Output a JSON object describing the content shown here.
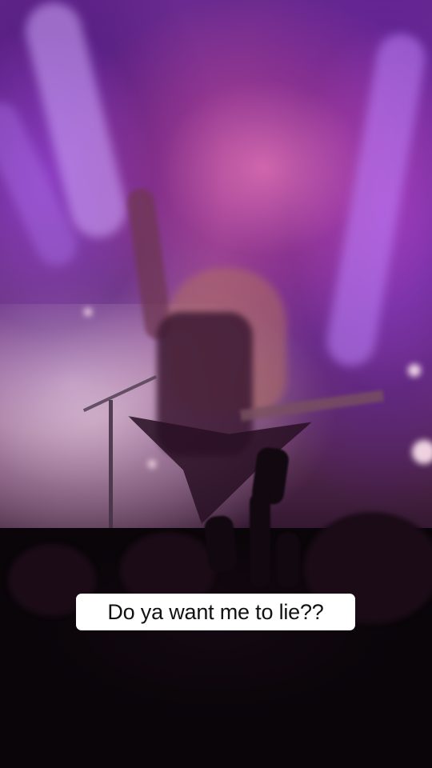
{
  "video": {
    "caption": "Do ya want me to lie??"
  },
  "colors": {
    "stage_purple": "#6a2a8f",
    "stage_pink": "#ee78b4",
    "caption_bg": "#ffffff",
    "caption_text": "#111111"
  }
}
